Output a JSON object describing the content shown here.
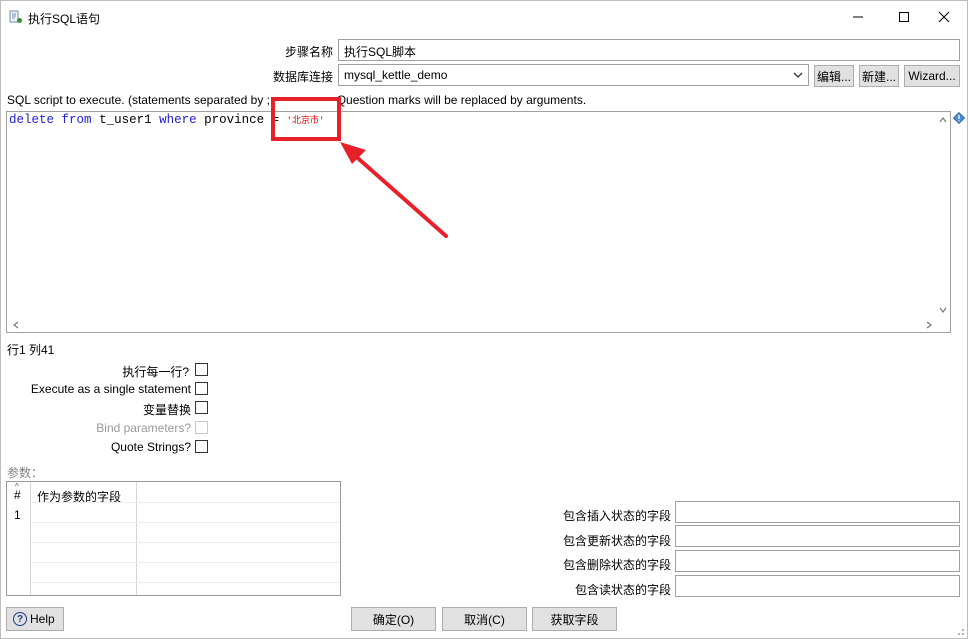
{
  "window": {
    "title": "执行SQL语句",
    "minimize_glyph": "—",
    "maximize_glyph": "☐",
    "close_glyph": "✕"
  },
  "form": {
    "step_name_label": "步骤名称",
    "step_name_value": "执行SQL脚本",
    "db_conn_label": "数据库连接",
    "db_conn_value": "mysql_kettle_demo",
    "edit_button": "编辑...",
    "new_button": "新建...",
    "wizard_button": "Wizard..."
  },
  "sql": {
    "hint": "SQL script to execute. (statements separated by ; ) Question marks will be replaced by arguments.",
    "hint_left": "SQL script to execute. (statements separated by ;",
    "hint_right": "Question marks will be replaced by arguments.",
    "code": {
      "kw1": "delete",
      "kw2": "from",
      "table": "t_user1",
      "kw3": "where",
      "rest": "province =",
      "string": "'北京市'"
    }
  },
  "status": {
    "position": "行1 列41"
  },
  "options": {
    "execute_each_row": "执行每一行?",
    "single_statement": "Execute as a single statement",
    "variable_substitution": "变量替换",
    "bind_parameters": "Bind parameters?",
    "quote_strings": "Quote Strings?"
  },
  "params": {
    "label": "参数：",
    "col_hash": "#",
    "col_field": "作为参数的字段",
    "rows": [
      "1"
    ]
  },
  "status_fields": {
    "insert": "包含插入状态的字段",
    "update": "包含更新状态的字段",
    "delete": "包含删除状态的字段",
    "read": "包含读状态的字段"
  },
  "buttons": {
    "help": "Help",
    "ok": "确定(O)",
    "cancel": "取消(C)",
    "get_fields": "获取字段"
  },
  "colors": {
    "keyword": "#1e1ed2",
    "string": "#e00000",
    "annotation": "#e8202a"
  }
}
